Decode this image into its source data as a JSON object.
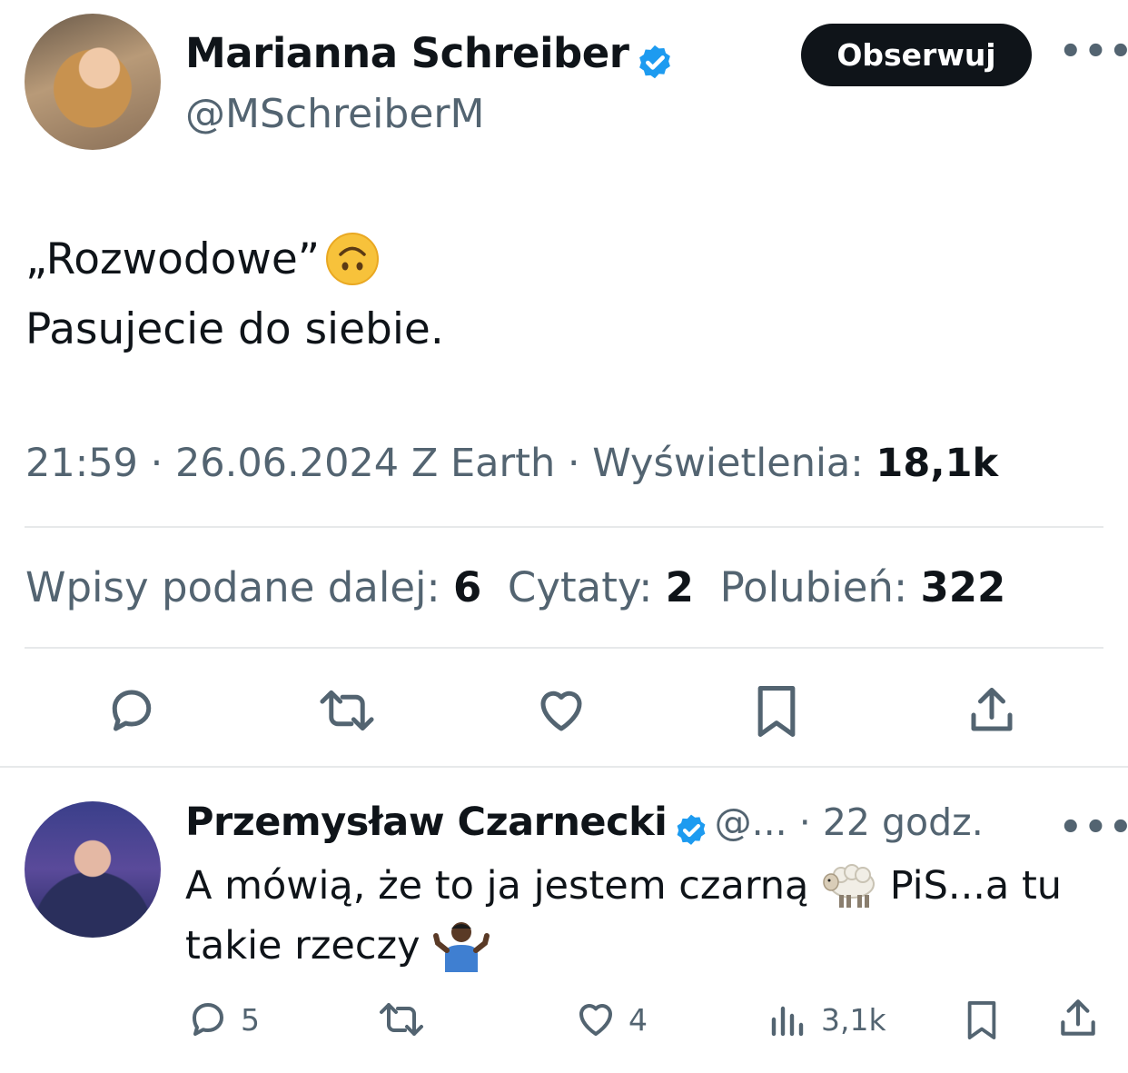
{
  "main_tweet": {
    "author_name": "Marianna Schreiber",
    "author_handle": "@MSchreiberM",
    "follow_label": "Obserwuj",
    "text_line1": "„Rozwodowe”",
    "text_line2": "Pasujecie do siebie.",
    "time": "21:59",
    "date": "26.06.2024",
    "source": "Z Earth",
    "views_label": "Wyświetlenia:",
    "views_count": "18,1k",
    "retweets_label": "Wpisy podane dalej:",
    "retweets_count": "6",
    "quotes_label": "Cytaty:",
    "quotes_count": "2",
    "likes_label": "Polubień:",
    "likes_count": "322",
    "emoji": "upside-down-face"
  },
  "reply": {
    "author_name": "Przemysław Czarnecki",
    "author_handle": "@...",
    "time_ago": "22 godz.",
    "text_part1": "A mówią, że to ja jestem czarną",
    "text_part2": "PiS...a tu",
    "text_line2": "takie rzeczy",
    "reply_count": "5",
    "like_count": "4",
    "view_count": "3,1k",
    "emojis": [
      "sheep",
      "person-shrugging"
    ]
  },
  "colors": {
    "text": "#0f1419",
    "secondary": "#536471",
    "verified": "#1d9bf0",
    "divider": "#e7e9ea"
  }
}
